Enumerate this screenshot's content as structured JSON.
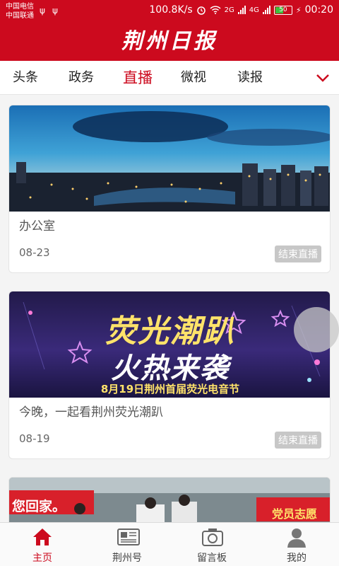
{
  "status_bar": {
    "carrier_1": "中国电信",
    "carrier_2": "中国联通",
    "usb_icon_glyph": "ψ",
    "speed": "100.8K/s",
    "net_1": "2G",
    "net_2": "4G",
    "battery": "50",
    "time": "00:20"
  },
  "header": {
    "logo": "荆州日报"
  },
  "tabs": [
    "头条",
    "政务",
    "直播",
    "微视",
    "读报"
  ],
  "active_tab": "直播",
  "cards": [
    {
      "title": "办公室",
      "date": "08-23",
      "badge": "结束直播"
    },
    {
      "title": "今晚，一起看荆州荧光潮趴",
      "date": "08-19",
      "badge": "结束直播",
      "poster_line1": "荧光潮趴",
      "poster_line2": "火热来袭",
      "poster_sub": "8月19日荆州首届荧光电音节"
    },
    {
      "banner_left": "您回家。",
      "banner_right": "党员志愿"
    }
  ],
  "bottom_nav": [
    {
      "label": "主页",
      "icon": "home-icon",
      "active": true
    },
    {
      "label": "荆州号",
      "icon": "newspaper-icon",
      "active": false
    },
    {
      "label": "留言板",
      "icon": "camera-icon",
      "active": false
    },
    {
      "label": "我的",
      "icon": "user-icon",
      "active": false
    }
  ],
  "colors": {
    "brand": "#cc0a1e",
    "badge": "#c7c7c7"
  }
}
